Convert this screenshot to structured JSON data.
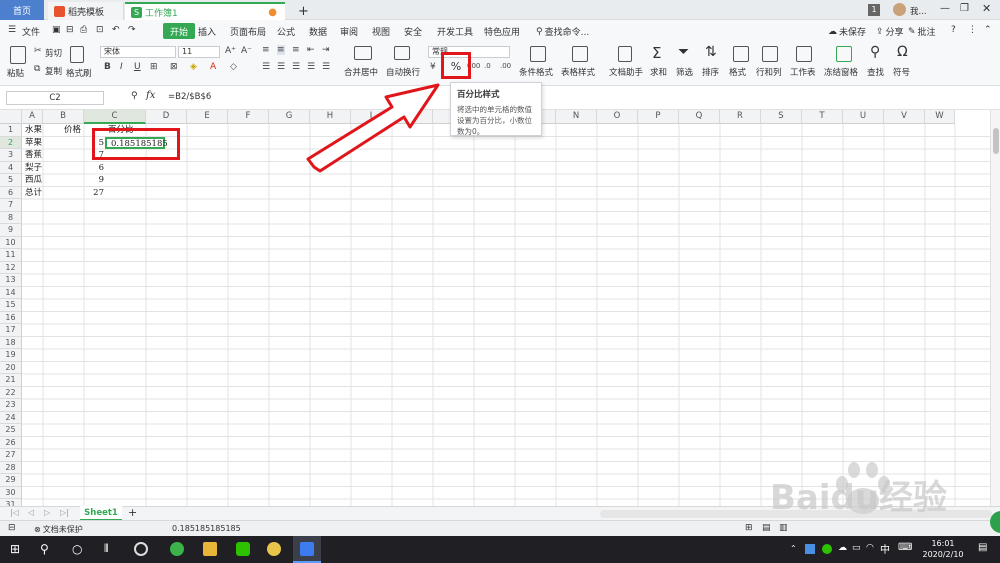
{
  "tabs": {
    "home": "首页",
    "template": "稻壳模板",
    "workbook": "工作簿1",
    "new_tab": "+",
    "badge": "1",
    "user": "我..."
  },
  "menu": {
    "file": "文件",
    "items": [
      "开始",
      "插入",
      "页面布局",
      "公式",
      "数据",
      "审阅",
      "视图",
      "安全",
      "开发工具",
      "特色应用"
    ],
    "search": "查找命令...",
    "unsaved": "未保存",
    "share": "分享",
    "annotate": "批注"
  },
  "toolbar": {
    "paste": "粘贴",
    "cut": "剪切",
    "copy": "复制",
    "format_painter": "格式刷",
    "font_name": "宋体",
    "font_size": "11",
    "merge_center": "合并居中",
    "wrap_text": "自动换行",
    "number_format": "常规",
    "percent_symbol": "%",
    "thousands_symbol": "000",
    "conditional_format": "条件格式",
    "table_style": "表格样式",
    "doc_helper": "文档助手",
    "sum": "求和",
    "filter": "筛选",
    "sort": "排序",
    "format": "格式",
    "row_col": "行和列",
    "worksheet": "工作表",
    "freeze": "冻结窗格",
    "find": "查找",
    "symbol": "符号"
  },
  "tooltip": {
    "title": "百分比样式",
    "body": "将选中的单元格的数值设置为百分比，小数位数为0。"
  },
  "formula_bar": {
    "cell_ref": "C2",
    "fx": "fx",
    "formula": "=B2/$B$6"
  },
  "columns": [
    "A",
    "B",
    "C",
    "D",
    "E",
    "F",
    "G",
    "H",
    "I",
    "J",
    "K",
    "L",
    "M",
    "N",
    "O",
    "P",
    "Q",
    "R",
    "S",
    "T",
    "U",
    "V",
    "W"
  ],
  "rows": [
    "1",
    "2",
    "3",
    "4",
    "5",
    "6",
    "7",
    "8",
    "9",
    "10",
    "11",
    "12",
    "13",
    "14",
    "15",
    "16",
    "17",
    "18",
    "19",
    "20",
    "21",
    "22",
    "23",
    "24",
    "25",
    "26",
    "27",
    "28",
    "29",
    "30",
    "31"
  ],
  "cells": {
    "a1": "水果",
    "b1": "价格",
    "c1": "百分比",
    "a2": "苹果",
    "b2": "5",
    "c2": "0.185185185",
    "a3": "香蕉",
    "b3": "7",
    "a4": "梨子",
    "b4": "6",
    "a5": "西瓜",
    "b5": "9",
    "a6": "总计",
    "b6": "27"
  },
  "sheet": {
    "name": "Sheet1",
    "add": "+"
  },
  "status": {
    "protect": "文档未保护",
    "value": "0.185185185185"
  },
  "taskbar": {
    "ime": "中",
    "time": "16:01",
    "date": "2020/2/10"
  },
  "watermark": "Baidu经验",
  "colors": {
    "accent_green": "#34a853",
    "tab_blue": "#4d7fcf",
    "annotation_red": "#e0161b"
  }
}
